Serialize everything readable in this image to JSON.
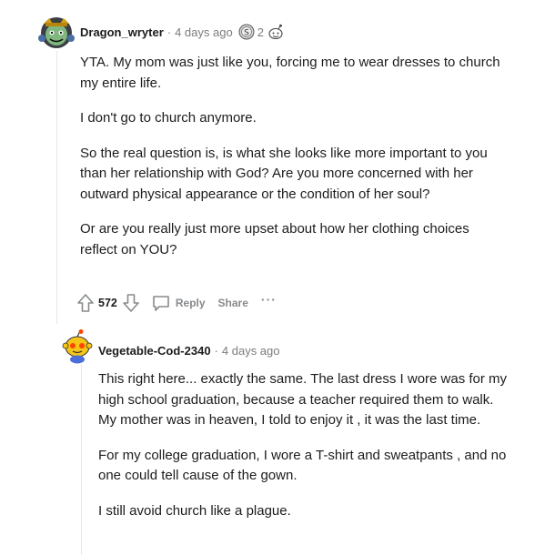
{
  "comment": {
    "username": "Dragon_wryter",
    "separator": "·",
    "time": "4 days ago",
    "award_count": "2",
    "paragraphs": [
      "YTA. My mom was just like you, forcing me to wear dresses to church my entire life.",
      "I don't go to church anymore.",
      "So the real question is, is what she looks like more important to you than her relationship with God? Are you more concerned with her outward physical appearance or the condition of her soul?",
      "Or are you really just more upset about how her clothing choices reflect on YOU?"
    ],
    "votes": "572",
    "reply_label": "Reply",
    "share_label": "Share",
    "more_label": "···"
  },
  "reply": {
    "username": "Vegetable-Cod-2340",
    "separator": "·",
    "time": "4 days ago",
    "paragraphs": [
      "This right here... exactly the same. The last dress I wore was for my high school graduation, because a teacher required them to walk. My mother was in heaven, I told to enjoy it , it was the last time.",
      "For my college graduation, I wore a T-shirt and sweatpants , and no one could tell cause of the gown.",
      "I still avoid church like a plague."
    ]
  },
  "icons": {
    "avatar_main": "snoo-avatar-icon",
    "avatar_reply": "snoo-avatar-icon",
    "award": "silver-award-icon",
    "award2": "helpful-award-icon",
    "upvote": "upvote-arrow-icon",
    "downvote": "downvote-arrow-icon",
    "reply": "comment-bubble-icon"
  },
  "colors": {
    "text": "#1c1c1c",
    "meta": "#7c7c7c",
    "action": "#878a8c",
    "thread_line": "#e6e8ea"
  }
}
